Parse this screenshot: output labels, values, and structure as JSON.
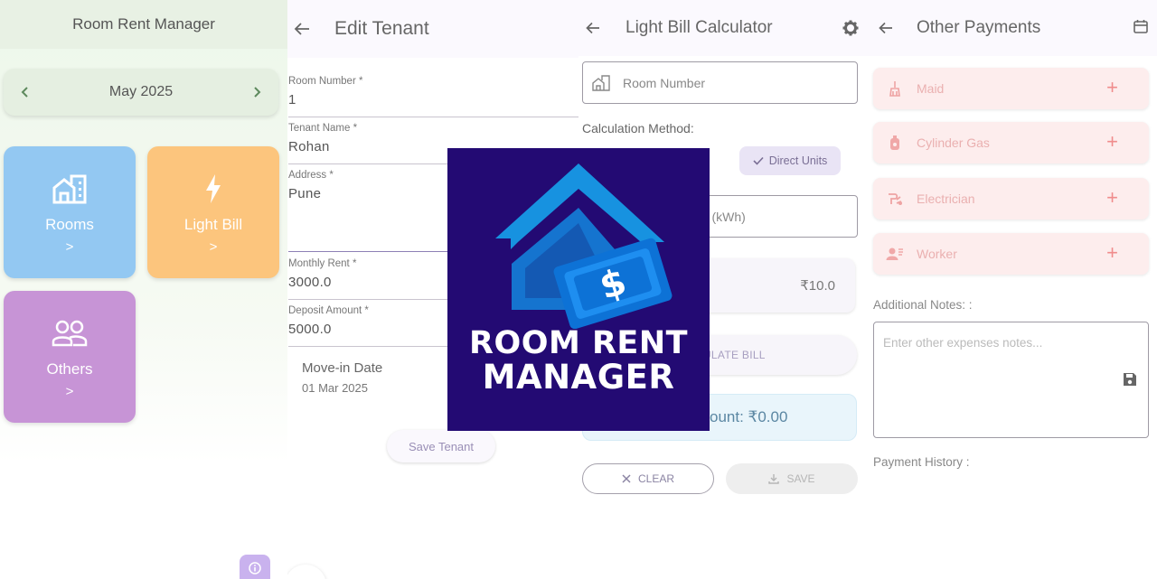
{
  "home": {
    "title": "Room Rent Manager",
    "month": "May 2025",
    "tiles": [
      {
        "label": "Rooms",
        "color": "#93c8f2"
      },
      {
        "label": "Light Bill",
        "color": "#fcc57d"
      },
      {
        "label": "Others",
        "color": "#c794d6"
      }
    ]
  },
  "edit_tenant": {
    "title": "Edit Tenant",
    "fields": [
      {
        "label": "Room Number *",
        "value": "1"
      },
      {
        "label": "Tenant Name *",
        "value": "Rohan"
      },
      {
        "label": "Address *",
        "value": "Pune"
      },
      {
        "label": "Monthly Rent *",
        "value": "3000.0"
      },
      {
        "label": "Deposit Amount *",
        "value": "5000.0"
      }
    ],
    "move_in_label": "Move-in Date",
    "move_in_value": "01 Mar 2025",
    "save_label": "Save Tenant"
  },
  "light_bill": {
    "title": "Light Bill Calculator",
    "room_number_placeholder": "Room Number",
    "calc_method_label": "Calculation Method:",
    "method_selected": "Direct Units",
    "units_placeholder_fragment": "ed (kWh)",
    "rate_value": "₹10.0",
    "calculate_fragment": "CULATE BILL",
    "total_fragment": "ount: ₹0.00",
    "clear_label": "CLEAR",
    "save_label": "SAVE"
  },
  "other_payments": {
    "title": "Other Payments",
    "items": [
      {
        "label": "Maid",
        "icon": "broom-icon"
      },
      {
        "label": "Cylinder Gas",
        "icon": "gas-cylinder-icon"
      },
      {
        "label": "Electrician",
        "icon": "electrician-icon"
      },
      {
        "label": "Worker",
        "icon": "worker-icon"
      }
    ],
    "notes_label": "Additional Notes: :",
    "notes_placeholder": "Enter other expenses notes...",
    "history_label": "Payment History :"
  },
  "logo": {
    "line1": "ROOM RENT",
    "line2": "MANAGER",
    "background": "#230a73"
  },
  "colors": {
    "accent": "#6750a4",
    "danger_light": "#fdeded",
    "plus": "#f08c8c"
  }
}
